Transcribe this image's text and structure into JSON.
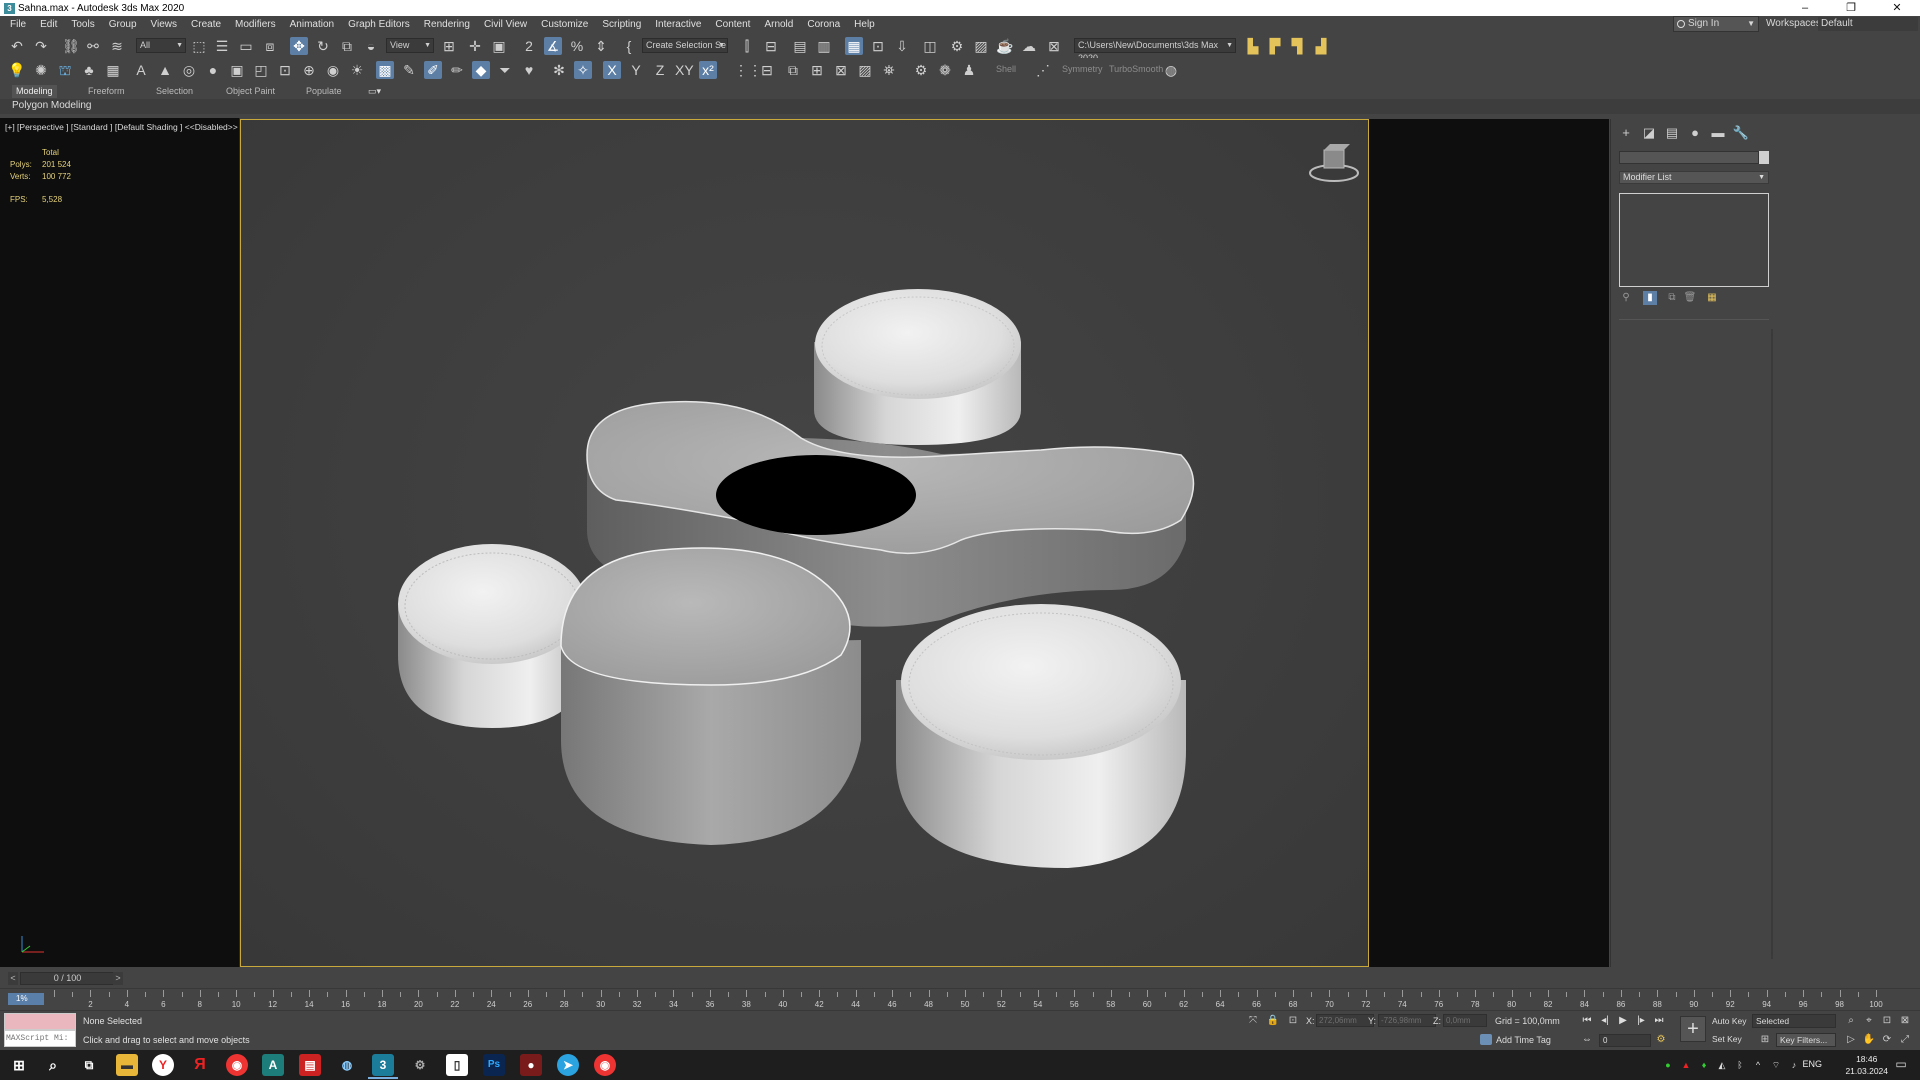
{
  "window": {
    "title": "Sahna.max - Autodesk 3ds Max 2020",
    "minimize": "–",
    "restore": "❐",
    "close": "✕"
  },
  "menu": [
    "File",
    "Edit",
    "Tools",
    "Group",
    "Views",
    "Create",
    "Modifiers",
    "Animation",
    "Graph Editors",
    "Rendering",
    "Civil View",
    "Customize",
    "Scripting",
    "Interactive",
    "Content",
    "Arnold",
    "Corona",
    "Help"
  ],
  "account": {
    "sign_in": "Sign In",
    "workspaces_label": "Workspaces:",
    "workspace": "Default"
  },
  "toolbar": {
    "selection_filter": "All",
    "ref_coord": "View",
    "named_selection": "Create Selection Se",
    "project_path": "C:\\Users\\New\\Documents\\3ds Max 2020",
    "shell": "Shell",
    "symmetry": "Symmetry",
    "turbosmooth": "TurboSmooth"
  },
  "ribbon": {
    "tabs": [
      "Modeling",
      "Freeform",
      "Selection",
      "Object Paint",
      "Populate"
    ],
    "active_tab": "Modeling",
    "panel": "Polygon Modeling"
  },
  "viewport": {
    "label": "[+] [Perspective ] [Standard ] [Default Shading ]  <<Disabled>>",
    "stats_header": "Total",
    "polys_label": "Polys:",
    "polys_value": "201 524",
    "verts_label": "Verts:",
    "verts_value": "100 772",
    "fps_label": "FPS:",
    "fps_value": "5,528"
  },
  "command_panel": {
    "modifier_list": "Modifier List"
  },
  "timeline": {
    "frame_display": "0 / 100",
    "current_frame_label": "1%",
    "ticks": [
      "2",
      "4",
      "6",
      "8",
      "10",
      "12",
      "14",
      "16",
      "18",
      "20",
      "22",
      "24",
      "26",
      "28",
      "30",
      "32",
      "34",
      "36",
      "38",
      "40",
      "42",
      "44",
      "46",
      "48",
      "50",
      "52",
      "54",
      "56",
      "58",
      "60",
      "62",
      "64",
      "66",
      "68",
      "70",
      "72",
      "74",
      "76",
      "78",
      "80",
      "82",
      "84",
      "86",
      "88",
      "90",
      "92",
      "94",
      "96",
      "98",
      "100"
    ]
  },
  "status": {
    "maxscript": "MAXScript Mi:",
    "selection": "None Selected",
    "prompt": "Click and drag to select and move objects",
    "x_label": "X:",
    "x_value": "272,06mm",
    "y_label": "Y:",
    "y_value": "-726,98mm",
    "z_label": "Z:",
    "z_value": "0,0mm",
    "grid": "Grid = 100,0mm",
    "add_time_tag": "Add Time Tag",
    "frame_field": "0",
    "auto_key": "Auto Key",
    "set_key": "Set Key",
    "selected_set": "Selected",
    "key_filters": "Key Filters..."
  },
  "taskbar": {
    "language": "ENG",
    "time": "18:46",
    "date": "21.03.2024"
  },
  "colors": {
    "viewport_border": "#c9a93c",
    "active_blue": "#5d7fa6",
    "stat_yellow": "#e6d37a",
    "panel_bg": "#444444",
    "dark_bg": "#0e0e0e"
  }
}
